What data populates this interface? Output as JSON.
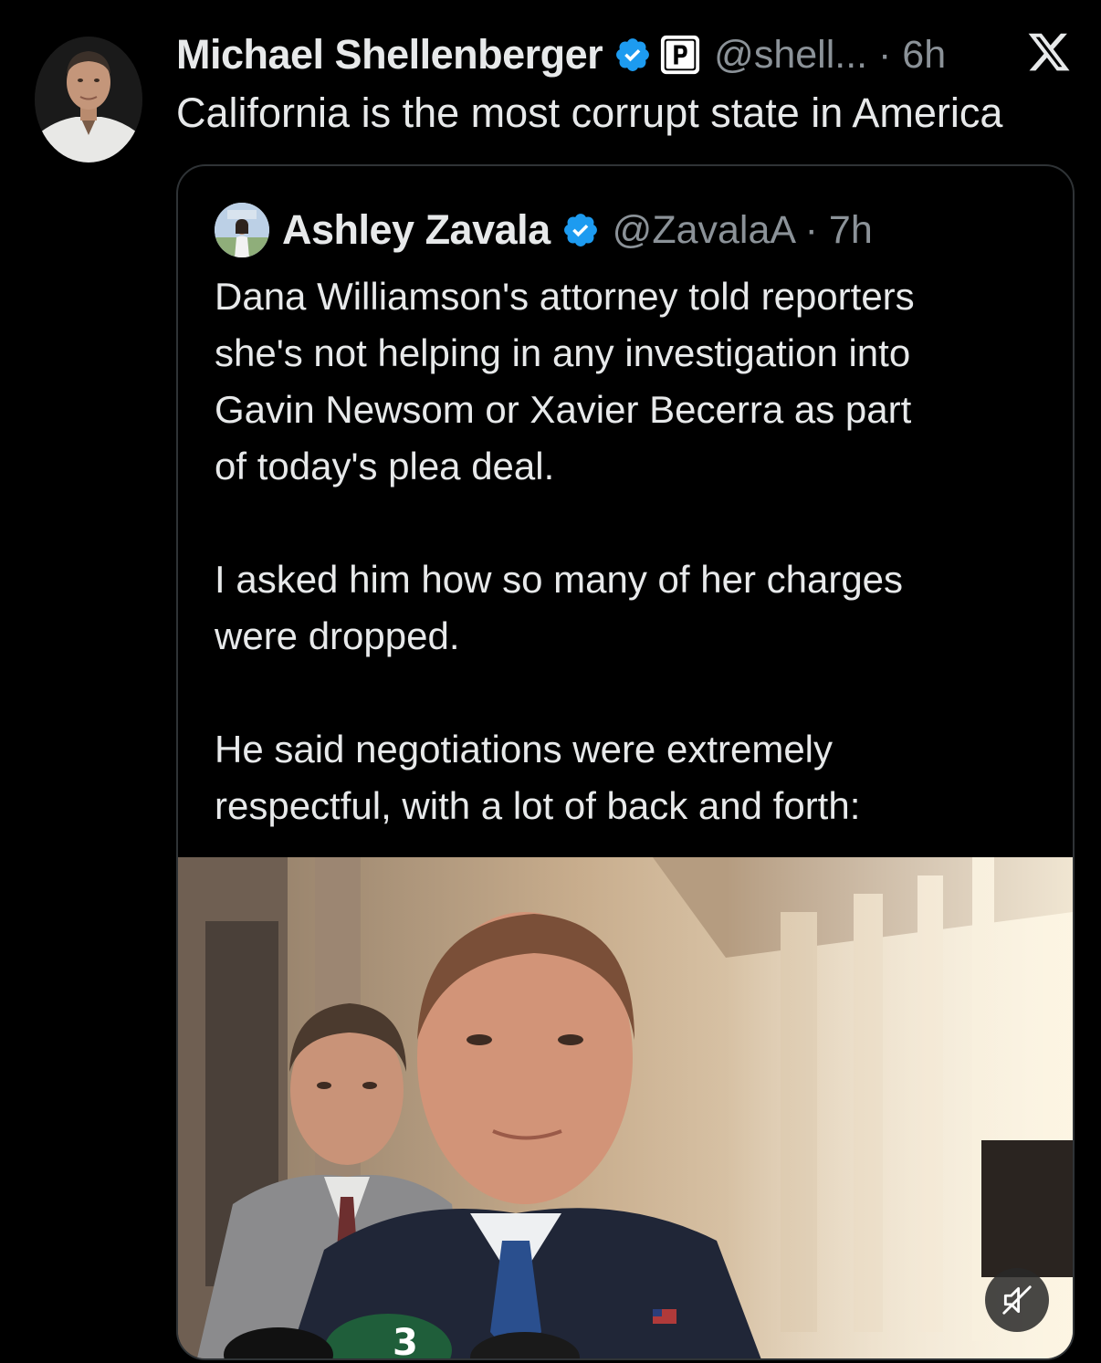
{
  "tweet": {
    "author_name": "Michael Shellenberger",
    "handle_time": "@shell... · 6h",
    "text": "California is the most corrupt state in America",
    "avatar_icon": "user-avatar",
    "verified_icon": "verified-badge-icon",
    "affiliate_icon": "p-badge-icon",
    "platform_icon": "x-logo-icon"
  },
  "quote": {
    "author_name": "Ashley Zavala",
    "handle_time": "@ZavalaA · 7h",
    "paragraphs": [
      [
        "Dana Williamson's attorney told reporters",
        "she's not helping in any investigation into",
        "Gavin Newsom or Xavier Becerra as part",
        "of today's plea deal."
      ],
      [
        "I asked him how so many of her charges",
        "were dropped."
      ],
      [
        "He said negotiations were extremely",
        "respectful, with a lot of back and forth:"
      ]
    ],
    "media": {
      "type": "video",
      "mute_icon": "muted-speaker-icon",
      "mic_flag_text": "3"
    }
  },
  "colors": {
    "background": "#000000",
    "text_primary": "#e7e9ea",
    "text_secondary": "#8b9298",
    "verified_blue": "#1d9bf0",
    "border": "#2f3336"
  }
}
